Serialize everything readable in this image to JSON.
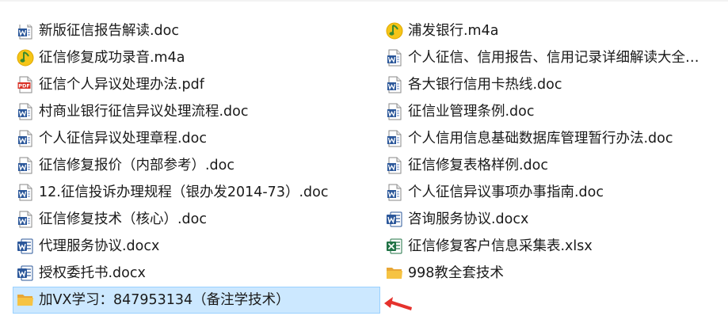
{
  "colors": {
    "selection_bg": "#cce8ff",
    "selection_border": "#99d1ff",
    "word_blue": "#2b579a",
    "excel_green": "#217346",
    "pdf_red": "#d93025",
    "folder_yellow": "#f6c343",
    "audio_green": "#6cb33e",
    "arrow_red": "#e5322d"
  },
  "left_column": [
    {
      "name": "新版征信报告解读.doc",
      "icon": "word-doc-icon"
    },
    {
      "name": "征信修复成功录音.m4a",
      "icon": "audio-icon"
    },
    {
      "name": "征信个人异议处理办法.pdf",
      "icon": "pdf-icon"
    },
    {
      "name": "村商业银行征信异议处理流程.doc",
      "icon": "word-doc-icon"
    },
    {
      "name": "个人征信异议处理章程.doc",
      "icon": "word-doc-icon"
    },
    {
      "name": "征信修复报价（内部参考）.doc",
      "icon": "word-doc-icon"
    },
    {
      "name": "12.征信投诉办理规程（银办发2014-73）.doc",
      "icon": "word-doc-icon"
    },
    {
      "name": "征信修复技术（核心）.doc",
      "icon": "word-doc-icon"
    },
    {
      "name": "代理服务协议.docx",
      "icon": "word-docx-icon"
    },
    {
      "name": "授权委托书.docx",
      "icon": "word-docx-icon"
    },
    {
      "name": "加VX学习：847953134（备注学技术）",
      "icon": "folder-icon",
      "selected": true
    }
  ],
  "right_column": [
    {
      "name": "浦发银行.m4a",
      "icon": "audio-icon"
    },
    {
      "name": "个人征信、信用报告、信用记录详细解读大全…",
      "icon": "word-doc-icon"
    },
    {
      "name": "各大银行信用卡热线.doc",
      "icon": "word-doc-icon"
    },
    {
      "name": "征信业管理条例.doc",
      "icon": "word-doc-icon"
    },
    {
      "name": "个人信用信息基础数据库管理暂行办法.doc",
      "icon": "word-doc-icon"
    },
    {
      "name": "征信修复表格样例.doc",
      "icon": "word-doc-icon"
    },
    {
      "name": "个人征信异议事项办事指南.doc",
      "icon": "word-doc-icon"
    },
    {
      "name": "咨询服务协议.docx",
      "icon": "word-docx-icon"
    },
    {
      "name": "征信修复客户信息采集表.xlsx",
      "icon": "excel-icon"
    },
    {
      "name": "998教全套技术",
      "icon": "folder-icon"
    }
  ]
}
